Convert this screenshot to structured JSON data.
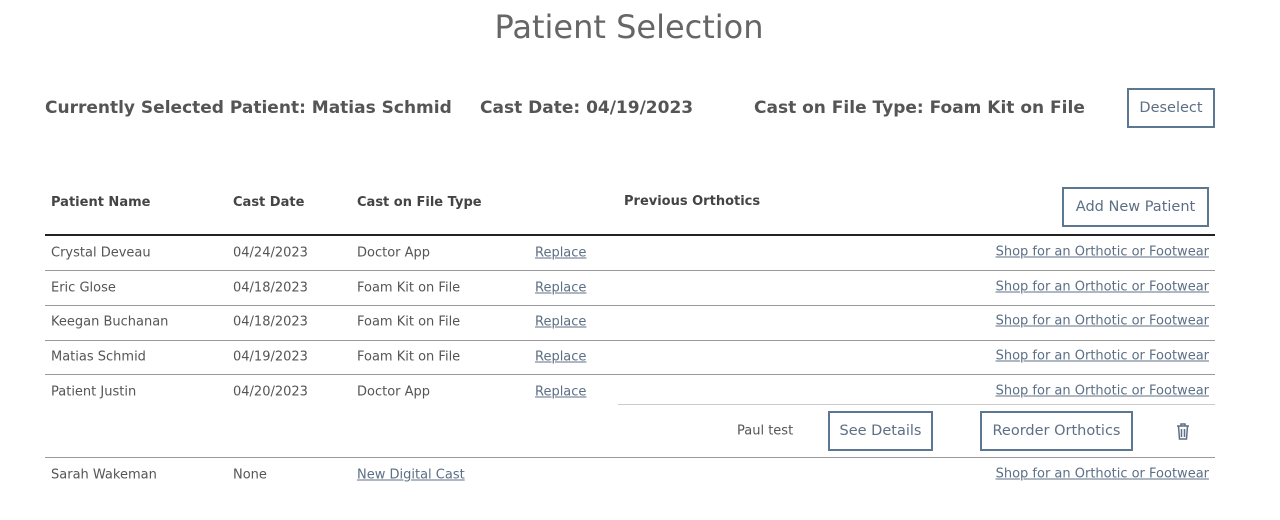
{
  "title": "Patient Selection",
  "selection": {
    "patient": "Currently Selected Patient: Matias Schmid",
    "cast_date": "Cast Date: 04/19/2023",
    "cast_type": "Cast on File Type: Foam Kit on File",
    "deselect": "Deselect"
  },
  "table": {
    "headers": [
      "Patient Name",
      "Cast Date",
      "Cast on File Type",
      "Previous Orthotics"
    ],
    "add_new": "Add New Patient",
    "rows": [
      {
        "name": "Crystal Deveau",
        "date": "04/24/2023",
        "type": "Doctor App",
        "action": "Replace",
        "shop": "Shop for an Orthotic or Footwear"
      },
      {
        "name": "Eric Glose",
        "date": "04/18/2023",
        "type": "Foam Kit on File",
        "action": "Replace",
        "shop": "Shop for an Orthotic or Footwear"
      },
      {
        "name": "Keegan Buchanan",
        "date": "04/18/2023",
        "type": "Foam Kit on File",
        "action": "Replace",
        "shop": "Shop for an Orthotic or Footwear"
      },
      {
        "name": "Matias Schmid",
        "date": "04/19/2023",
        "type": "Foam Kit on File",
        "action": "Replace",
        "shop": "Shop for an Orthotic or Footwear"
      },
      {
        "name": "Patient Justin",
        "date": "04/20/2023",
        "type": "Doctor App",
        "action": "Replace",
        "shop": "Shop for an Orthotic or Footwear"
      },
      {
        "name": "Sarah Wakeman",
        "date": "None",
        "type": "",
        "action": "New Digital Cast",
        "shop": "Shop for an Orthotic or Footwear"
      }
    ],
    "orthotic": {
      "name": "Paul test",
      "see_details": "See Details",
      "reorder": "Reorder Orthotics",
      "delete_icon": "trash-icon"
    }
  }
}
